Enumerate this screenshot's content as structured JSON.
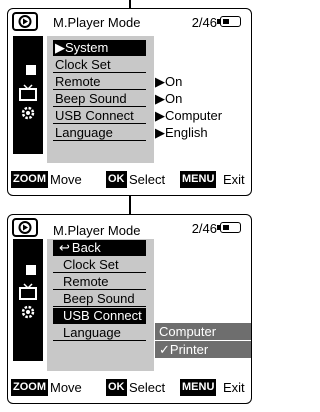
{
  "screens": [
    {
      "header": {
        "mode": "M.Player Mode",
        "count": "2/46"
      },
      "menu": [
        {
          "label": "System",
          "prefix": "▶",
          "selected": true
        },
        {
          "label": "Clock Set",
          "prefix": ""
        },
        {
          "label": "Remote",
          "prefix": ""
        },
        {
          "label": "Beep Sound",
          "prefix": ""
        },
        {
          "label": "USB Connect",
          "prefix": ""
        },
        {
          "label": "Language",
          "prefix": ""
        }
      ],
      "values": [
        "▶On",
        "▶On",
        "▶Computer",
        "▶English"
      ],
      "footer": {
        "zoom_key": "ZOOM",
        "zoom_label": "Move",
        "ok_key": "OK",
        "ok_label": "Select",
        "menu_key": "MENU",
        "menu_label": "Exit"
      }
    },
    {
      "header": {
        "mode": "M.Player Mode",
        "count": "2/46"
      },
      "menu": [
        {
          "label": "Back",
          "prefix": "↩"
        },
        {
          "label": "Clock Set",
          "prefix": ""
        },
        {
          "label": "Remote",
          "prefix": ""
        },
        {
          "label": "Beep Sound",
          "prefix": ""
        },
        {
          "label": "USB Connect",
          "prefix": "",
          "selected": true
        },
        {
          "label": "Language",
          "prefix": ""
        }
      ],
      "popup": [
        "Computer",
        "✓Printer"
      ],
      "footer": {
        "zoom_key": "ZOOM",
        "zoom_label": "Move",
        "ok_key": "OK",
        "ok_label": "Select",
        "menu_key": "MENU",
        "menu_label": "Exit"
      }
    }
  ]
}
